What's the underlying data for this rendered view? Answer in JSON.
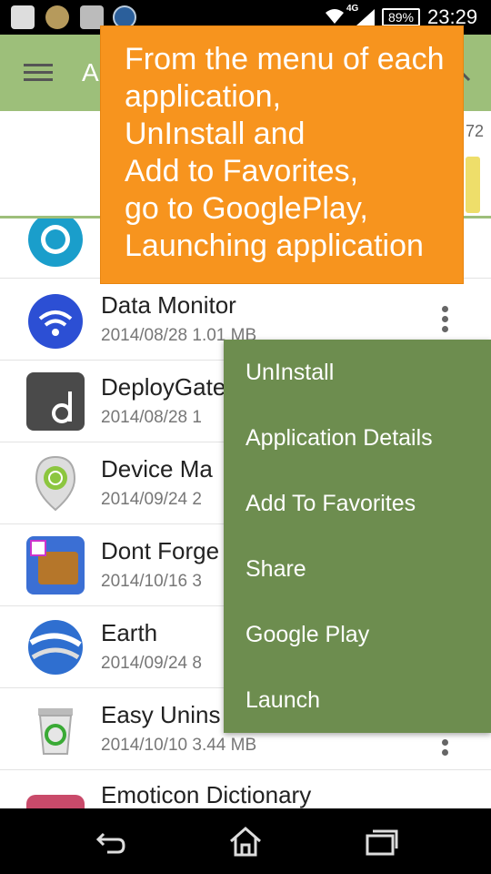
{
  "status_bar": {
    "network": "4G",
    "battery": "89%",
    "time": "23:29"
  },
  "app_bar": {
    "title": "A"
  },
  "header": {
    "count": "72"
  },
  "apps": [
    {
      "name": "",
      "meta": "",
      "icon": "chrome-remote-desktop-icon"
    },
    {
      "name": "Data Monitor",
      "meta": "2014/08/28  1.01 MB",
      "icon": "wifi-data-icon"
    },
    {
      "name": "DeployGate",
      "meta": "2014/08/28  1",
      "icon": "deploygate-icon"
    },
    {
      "name": "Device Ma",
      "meta": "2014/09/24  2",
      "icon": "device-manager-icon"
    },
    {
      "name": "Dont Forge",
      "meta": "2014/10/16  3",
      "icon": "wallet-icon"
    },
    {
      "name": "Earth",
      "meta": "2014/09/24  8",
      "icon": "earth-icon"
    },
    {
      "name": "Easy Unins",
      "meta": "2014/10/10  3.44 MB",
      "icon": "recycle-bin-icon"
    },
    {
      "name": "Emoticon Dictionary",
      "meta": "",
      "icon": "emoticon-icon"
    }
  ],
  "menu": {
    "items": [
      "UnInstall",
      "Application Details",
      "Add To Favorites",
      "Share",
      "Google Play",
      "Launch"
    ]
  },
  "tooltip": {
    "lines": [
      "From the menu of each",
      "application,",
      "UnInstall and",
      "Add to Favorites,",
      "go to GooglePlay,",
      "Launching application"
    ]
  },
  "colors": {
    "app_bar": "#9dbf7a",
    "menu": "#6d8d4f",
    "tooltip": "#f7941e"
  }
}
